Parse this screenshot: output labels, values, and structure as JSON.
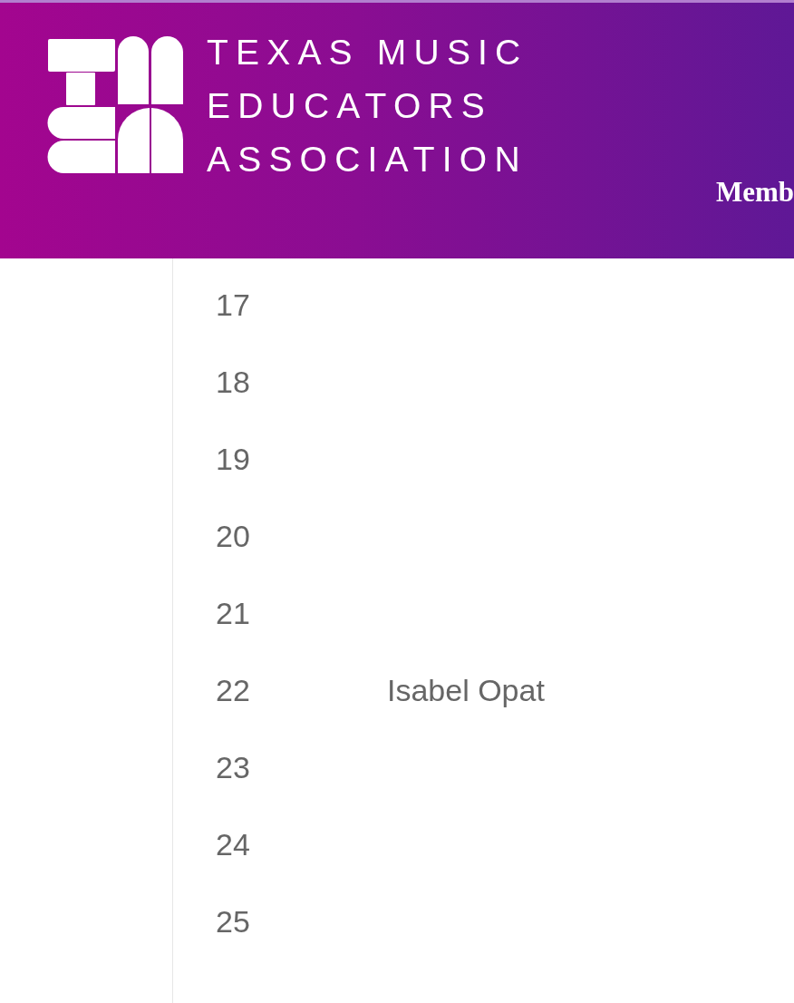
{
  "header": {
    "logo": {
      "wordmark_lines": [
        "TEXAS MUSIC",
        "EDUCATORS",
        "ASSOCIATION"
      ]
    },
    "nav": [
      {
        "label": "Memb"
      }
    ]
  },
  "list": {
    "rows": [
      {
        "number": "17"
      },
      {
        "number": "18"
      },
      {
        "number": "19"
      },
      {
        "number": "20"
      },
      {
        "number": "21"
      },
      {
        "number": "22",
        "name": "Isabel Opat"
      },
      {
        "number": "23"
      },
      {
        "number": "24"
      },
      {
        "number": "25"
      }
    ]
  }
}
